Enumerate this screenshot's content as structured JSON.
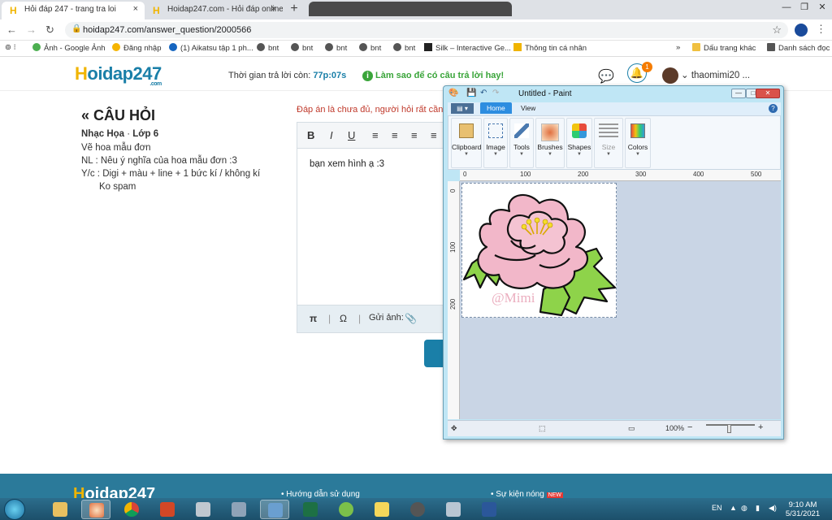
{
  "browser": {
    "tabs": [
      {
        "title": "Hỏi đáp 247 - trang tra loi",
        "close": "×"
      },
      {
        "title": "Hoidap247.com - Hỏi đáp online",
        "close": "×"
      }
    ],
    "new_tab": "+",
    "window_controls": {
      "minimize": "—",
      "restore": "❐",
      "close": "✕"
    },
    "url": "hoidap247.com/answer_question/2000566",
    "bookmarks": [
      "Ảnh - Google Ảnh",
      "Đăng nhập",
      "(1) Aikatsu tập 1 ph...",
      "bnt",
      "bnt",
      "bnt",
      "bnt",
      "bnt",
      "Silk – Interactive Ge...",
      "Thông tin cá nhân"
    ],
    "bookmarks_more": "»",
    "other_bookmarks": "Dấu trang khác",
    "reading_list": "Danh sách đọc"
  },
  "site": {
    "logo_h": "H",
    "logo_rest": "oidap247",
    "logo_com": ".com",
    "timer_label": "Thời gian trả lời còn:",
    "timer_value": "77p:07s",
    "tip": "Làm sao để có câu trả lời hay!",
    "tip_icon": "i",
    "notification_count": "1",
    "username": "thaomimi20 ..."
  },
  "question": {
    "heading": "CÂU HỎI",
    "subject": "Nhạc Họa",
    "separator": " · ",
    "grade": "Lớp 6",
    "lines": [
      "Vẽ hoa mẫu đơn",
      "NL : Nêu ý nghĩa của hoa mẫu đơn :3",
      "Y/c : Digi + màu + line + 1 bức kí / không kí",
      "Ko spam"
    ]
  },
  "answer": {
    "warning": "Đáp án là chưa đủ, người hỏi rất cần",
    "toolbar": {
      "bold": "B",
      "italic": "I",
      "underline": "U"
    },
    "text": "bạn xem hình ạ :3",
    "footer": {
      "pi": "π",
      "sep": "|",
      "omega": "Ω",
      "send_image": "Gửi ảnh:"
    }
  },
  "footer": {
    "logo_h": "H",
    "logo_rest": "oidap247",
    "link1": "• Hướng dẫn sử dụng",
    "link2": "• Sự kiện nóng",
    "new_badge": "NEW"
  },
  "paint": {
    "title": "Untitled - Paint",
    "tabs": {
      "home": "Home",
      "view": "View"
    },
    "help": "?",
    "ribbon": [
      "Clipboard",
      "Image",
      "Tools",
      "Brushes",
      "Shapes",
      "Size",
      "Colors"
    ],
    "ruler_top": [
      "0",
      "100",
      "200",
      "300",
      "400",
      "500"
    ],
    "ruler_left": [
      "0",
      "100",
      "200"
    ],
    "watermark": "@Mimi",
    "zoom": "100%",
    "zoom_out": "−",
    "zoom_in": "+"
  },
  "taskbar": {
    "lang": "EN",
    "time": "9:10 AM",
    "date": "5/31/2021"
  },
  "colors": {
    "brand": "#1a7fa8",
    "accent": "#f0b400",
    "warning": "#c0392b",
    "success": "#3aa53a",
    "peony_petal": "#f2b7c9",
    "leaf": "#8ed34a",
    "stamen": "#f5dd2a"
  }
}
